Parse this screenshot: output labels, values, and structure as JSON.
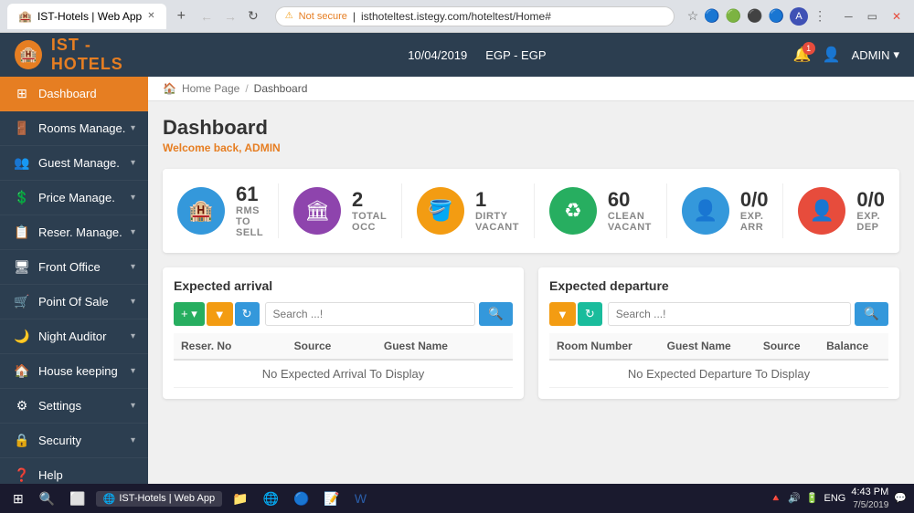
{
  "browser": {
    "tab_title": "IST-Hotels | Web App",
    "url": "isthoteltest.istegy.com/hoteltest/Home#",
    "protocol": "Not secure"
  },
  "app": {
    "logo_prefix": "IST",
    "logo_suffix": " - HOTELS",
    "date": "10/04/2019",
    "currency": "EGP - EGP",
    "admin_label": "ADMIN",
    "notif_count": "1"
  },
  "breadcrumb": {
    "home": "Home Page",
    "sep": "/",
    "current": "Dashboard"
  },
  "dashboard": {
    "title": "Dashboard",
    "welcome": "Welcome back, ",
    "admin_name": "ADMIN"
  },
  "stats": [
    {
      "number": "61",
      "label": "RMS TO SELL",
      "icon": "🏨",
      "color": "#3498db"
    },
    {
      "number": "2",
      "label": "TOTAL OCC",
      "icon": "🏛",
      "color": "#8e44ad"
    },
    {
      "number": "1",
      "label": "DIRTY VACANT",
      "icon": "🪣",
      "color": "#f39c12"
    },
    {
      "number": "60",
      "label": "CLEAN VACANT",
      "icon": "♻",
      "color": "#27ae60"
    },
    {
      "number": "0/0",
      "label": "EXP. ARR",
      "icon": "👤",
      "color": "#3498db"
    },
    {
      "number": "0/0",
      "label": "EXP. DEP",
      "icon": "👤",
      "color": "#e74c3c"
    }
  ],
  "arrival_section": {
    "title": "Expected arrival",
    "search_placeholder": "Search ...!",
    "empty_message": "No Expected Arrival To Display",
    "columns": [
      "Reser. No",
      "Source",
      "Guest Name"
    ]
  },
  "departure_section": {
    "title": "Expected departure",
    "search_placeholder": "Search ...!",
    "empty_message": "No Expected Departure To Display",
    "columns": [
      "Room Number",
      "Guest Name",
      "Source",
      "Balance"
    ]
  },
  "sidebar": {
    "items": [
      {
        "label": "Dashboard",
        "icon": "⊞",
        "active": true
      },
      {
        "label": "Rooms Manage.",
        "icon": "🚪",
        "active": false
      },
      {
        "label": "Guest Manage.",
        "icon": "👥",
        "active": false
      },
      {
        "label": "Price Manage.",
        "icon": "💲",
        "active": false
      },
      {
        "label": "Reser. Manage.",
        "icon": "📋",
        "active": false
      },
      {
        "label": "Front Office",
        "icon": "🖥",
        "active": false
      },
      {
        "label": "Point Of Sale",
        "icon": "🛒",
        "active": false
      },
      {
        "label": "Night Auditor",
        "icon": "🌙",
        "active": false
      },
      {
        "label": "House keeping",
        "icon": "🏠",
        "active": false
      },
      {
        "label": "Settings",
        "icon": "⚙",
        "active": false
      },
      {
        "label": "Security",
        "icon": "🔒",
        "active": false
      },
      {
        "label": "Help",
        "icon": "❓",
        "active": false
      }
    ]
  },
  "taskbar": {
    "time": "4:43 PM",
    "date": "7/5/2019",
    "lang": "ENG",
    "active_app": "IST-Hotels | Web App"
  }
}
